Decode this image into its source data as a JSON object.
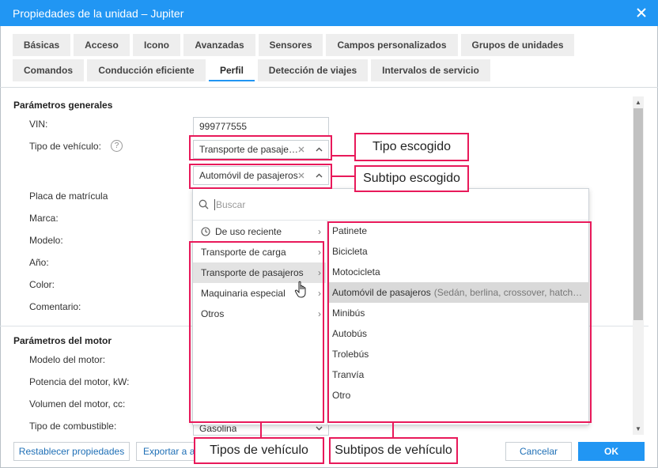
{
  "window": {
    "title": "Propiedades de la unidad – Jupiter"
  },
  "tabs": [
    {
      "label": "Básicas"
    },
    {
      "label": "Acceso"
    },
    {
      "label": "Icono"
    },
    {
      "label": "Avanzadas"
    },
    {
      "label": "Sensores"
    },
    {
      "label": "Campos personalizados"
    },
    {
      "label": "Grupos de unidades"
    },
    {
      "label": "Comandos"
    },
    {
      "label": "Conducción eficiente"
    },
    {
      "label": "Perfil",
      "active": true
    },
    {
      "label": "Detección de viajes"
    },
    {
      "label": "Intervalos de servicio"
    }
  ],
  "general": {
    "title": "Parámetros generales",
    "vin_label": "VIN:",
    "vin_value": "999777555",
    "vehicle_type_label": "Tipo de vehículo:",
    "help_glyph": "?",
    "vehicle_type_value": "Transporte de pasajeros",
    "vehicle_subtype_value": "Automóvil de pasajeros",
    "plate_label": "Placa de matrícula",
    "brand_label": "Marca:",
    "model_label": "Modelo:",
    "year_label": "Año:",
    "color_label": "Color:",
    "comment_label": "Comentario:"
  },
  "engine": {
    "title": "Parámetros del motor",
    "model_label": "Modelo del motor:",
    "power_label": "Potencia del motor, kW:",
    "volume_label": "Volumen del motor, cc:",
    "fuel_label": "Tipo de combustible:",
    "fuel_value": "Gasolina"
  },
  "dropdown": {
    "search_placeholder": "Buscar",
    "categories": [
      {
        "label": "De uso reciente"
      },
      {
        "label": "Transporte de carga"
      },
      {
        "label": "Transporte de pasajeros",
        "hover": true
      },
      {
        "label": "Maquinaria especial"
      },
      {
        "label": "Otros"
      }
    ],
    "subtypes": [
      {
        "label": "Patinete"
      },
      {
        "label": "Bicicleta"
      },
      {
        "label": "Motocicleta"
      },
      {
        "label": "Automóvil de pasajeros",
        "hint": "(Sedán, berlina, crossover, hatch…",
        "selected": true
      },
      {
        "label": "Minibús"
      },
      {
        "label": "Autobús"
      },
      {
        "label": "Trolebús"
      },
      {
        "label": "Tranvía"
      },
      {
        "label": "Otro"
      }
    ]
  },
  "callouts": {
    "tipo_escogido": "Tipo escogido",
    "subtipo_escogido": "Subtipo escogido",
    "tipos": "Tipos de vehículo",
    "subtipos": "Subtipos de vehículo"
  },
  "footer": {
    "reset_label": "Restablecer propiedades",
    "export_label": "Exportar a ar",
    "cancel_label": "Cancelar",
    "ok_label": "OK"
  },
  "colors": {
    "accent": "#2196f3",
    "callout": "#e8195a",
    "hover": "#e3e3e3"
  },
  "icons": [
    "close-icon",
    "help-icon",
    "clear-icon",
    "chevron-up-icon",
    "search-icon",
    "clock-icon",
    "chevron-right-icon",
    "hand-cursor-icon",
    "scroll-up-icon",
    "scroll-down-icon"
  ]
}
